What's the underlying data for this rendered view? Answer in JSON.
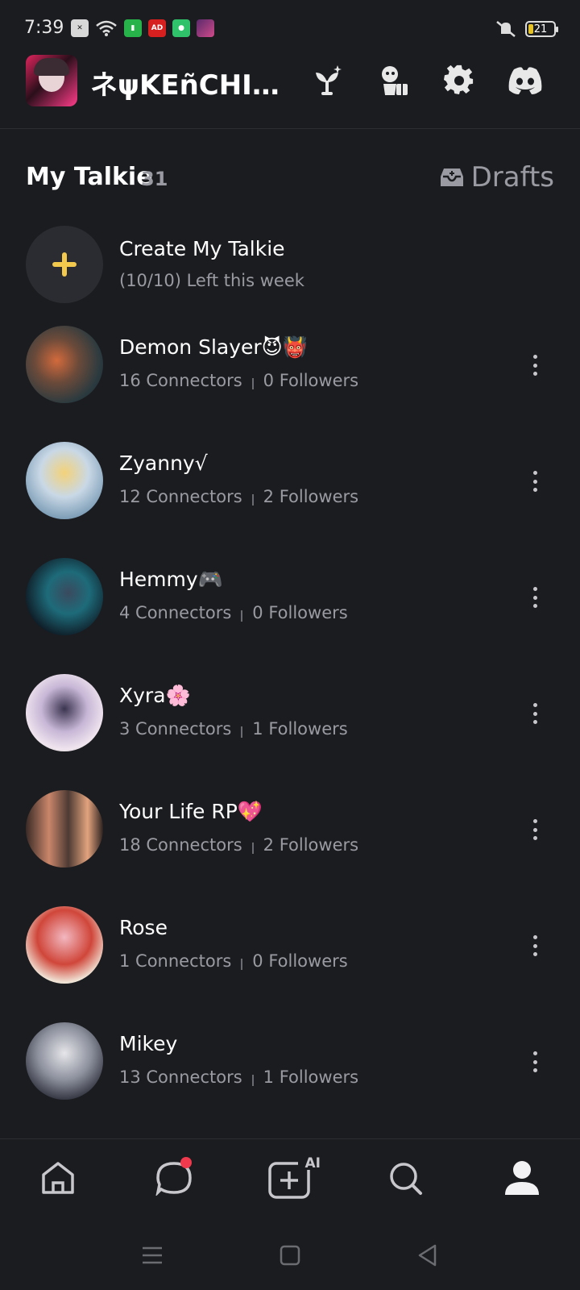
{
  "status_bar": {
    "time": "7:39",
    "battery": "21"
  },
  "header": {
    "username": "ネψKEñCHIR…",
    "icons": [
      "sprout-sparkle-icon",
      "character-gift-icon",
      "gear-icon",
      "discord-icon"
    ]
  },
  "section": {
    "title": "My Talkie",
    "count": "31",
    "drafts_label": "Drafts"
  },
  "create": {
    "title": "Create My Talkie",
    "subtitle": "(10/10) Left this week"
  },
  "talkies": [
    {
      "name": "Demon Slayer😈👹",
      "connectors": "16 Connectors",
      "followers": "0 Followers"
    },
    {
      "name": "Zyanny√",
      "connectors": "12 Connectors",
      "followers": "2 Followers"
    },
    {
      "name": "Hemmy🎮",
      "connectors": "4 Connectors",
      "followers": "0 Followers"
    },
    {
      "name": "Xyra🌸",
      "connectors": "3 Connectors",
      "followers": "1 Followers"
    },
    {
      "name": "Your Life RP💖",
      "connectors": "18 Connectors",
      "followers": "2 Followers"
    },
    {
      "name": "Rose",
      "connectors": "1 Connectors",
      "followers": "0 Followers"
    },
    {
      "name": "Mikey",
      "connectors": "13 Connectors",
      "followers": "1 Followers"
    }
  ],
  "bottom_nav": {
    "create_badge": "AI",
    "items": [
      "home-icon",
      "chat-icon",
      "create-ai-icon",
      "search-icon",
      "profile-icon"
    ]
  },
  "colors": {
    "background": "#1b1c20",
    "secondary_text": "#9a9ba2",
    "plus_accent": "#f2c94c",
    "notification_dot": "#f0394d"
  }
}
